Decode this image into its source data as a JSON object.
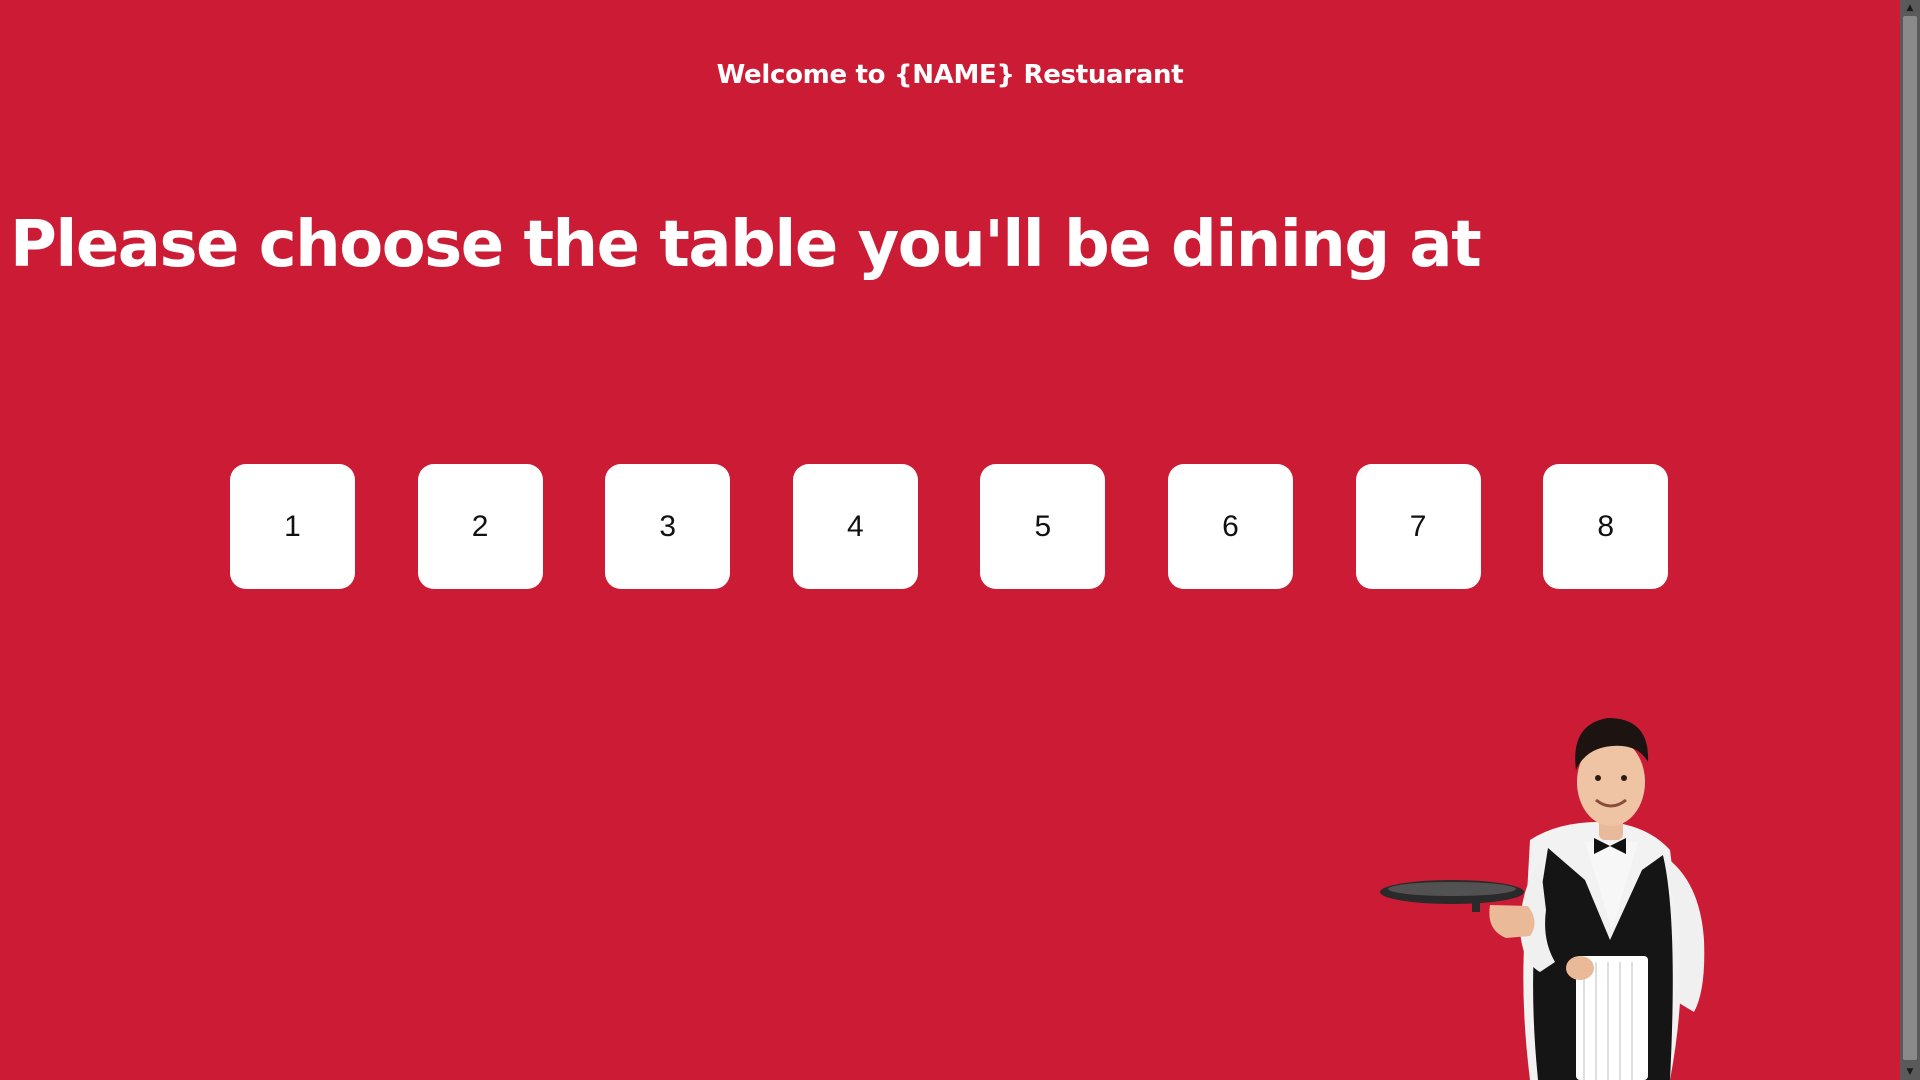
{
  "header": {
    "welcome": "Welcome to {NAME} Restuarant"
  },
  "main": {
    "headline": "Please choose the table you'll be dining at",
    "tables": [
      "1",
      "2",
      "3",
      "4",
      "5",
      "6",
      "7",
      "8"
    ]
  },
  "colors": {
    "background": "#cc1c35",
    "button": "#ffffff",
    "text": "#ffffff"
  },
  "icons": {
    "scroll_up": "triangle-up-icon",
    "scroll_down": "triangle-down-icon"
  }
}
